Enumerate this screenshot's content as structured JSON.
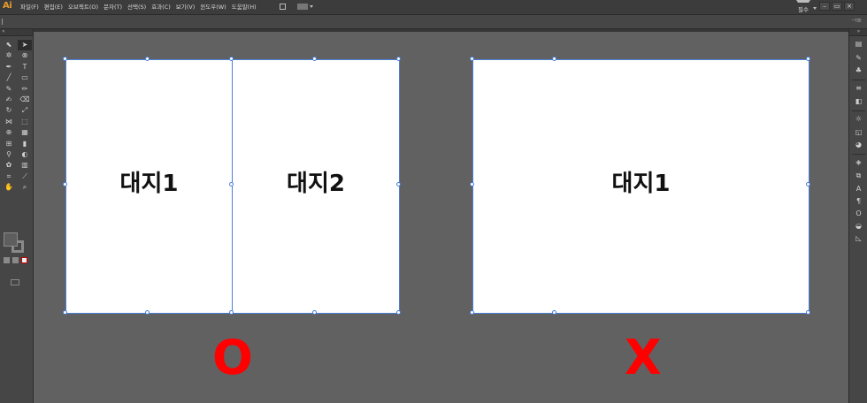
{
  "app": {
    "logo_text": "Ai"
  },
  "menu": [
    "파일(F)",
    "편집(E)",
    "오브젝트(O)",
    "문자(T)",
    "선택(S)",
    "효과(C)",
    "보기(V)",
    "윈도우(W)",
    "도움말(H)"
  ],
  "workspace": {
    "label": "필수"
  },
  "window_controls": {
    "minimize": "–",
    "restore": "▭",
    "close": "×"
  },
  "toolbar_icons": [
    "selection-tool",
    "direct-selection-tool",
    "magic-wand-tool",
    "lasso-tool",
    "pen-tool",
    "type-tool",
    "line-tool",
    "rectangle-tool",
    "paintbrush-tool",
    "pencil-tool",
    "blob-brush-tool",
    "eraser-tool",
    "rotate-tool",
    "scale-tool",
    "width-tool",
    "free-transform-tool",
    "shape-builder-tool",
    "perspective-grid-tool",
    "mesh-tool",
    "gradient-tool",
    "eyedropper-tool",
    "blend-tool",
    "symbol-sprayer-tool",
    "column-graph-tool",
    "artboard-tool",
    "slice-tool",
    "hand-tool",
    "zoom-tool"
  ],
  "canvas": {
    "artboards_left": [
      {
        "label": "대지1"
      },
      {
        "label": "대지2"
      }
    ],
    "artboards_right": [
      {
        "label": "대지1"
      }
    ],
    "mark_correct": "O",
    "mark_wrong": "X"
  },
  "colors": {
    "selection": "#4a7fd6",
    "mark": "#ff0000",
    "canvas_bg": "#616161",
    "ui_bg": "#464646"
  }
}
